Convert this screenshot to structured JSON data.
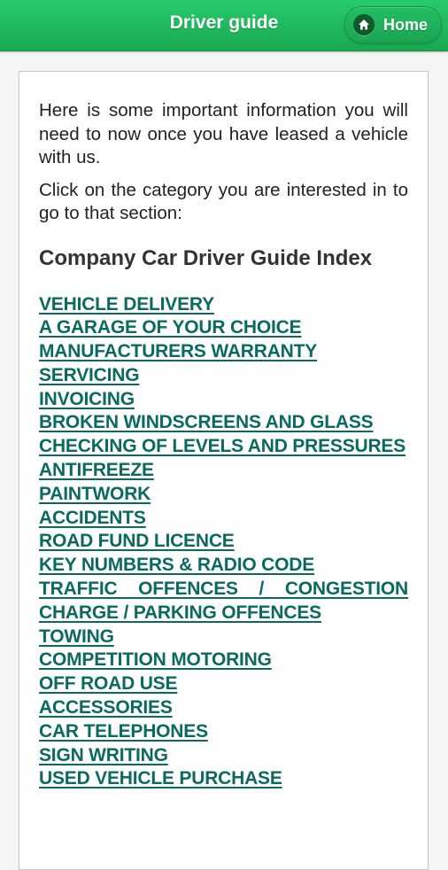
{
  "header": {
    "title": "Driver guide",
    "home_button": {
      "label": "Home",
      "icon": "home-icon"
    }
  },
  "colors": {
    "header_green": "#22c25f",
    "link_teal": "#0b6a60",
    "home_icon_bg": "#0f5a2a"
  },
  "content": {
    "intro_paragraph": "Here is some important information you will need to now once you have leased a vehicle with us.",
    "instruction_paragraph": "Click on the category you are interested in to go to that section:",
    "index_title": "Company Car Driver Guide Index",
    "links": [
      "VEHICLE DELIVERY",
      "A GARAGE OF YOUR CHOICE",
      "MANUFACTURERS WARRANTY",
      "SERVICING",
      "INVOICING",
      "BROKEN WINDSCREENS AND GLASS",
      "CHECKING OF LEVELS AND PRESSURES",
      "ANTIFREEZE",
      "PAINTWORK",
      "ACCIDENTS",
      "ROAD FUND LICENCE",
      "KEY NUMBERS & RADIO CODE",
      "TRAFFIC OFFENCES / CONGESTION CHARGE / PARKING OFFENCES",
      "TOWING",
      "COMPETITION MOTORING",
      "OFF ROAD USE",
      "ACCESSORIES",
      "CAR TELEPHONES",
      "SIGN WRITING",
      "USED VEHICLE PURCHASE"
    ]
  }
}
